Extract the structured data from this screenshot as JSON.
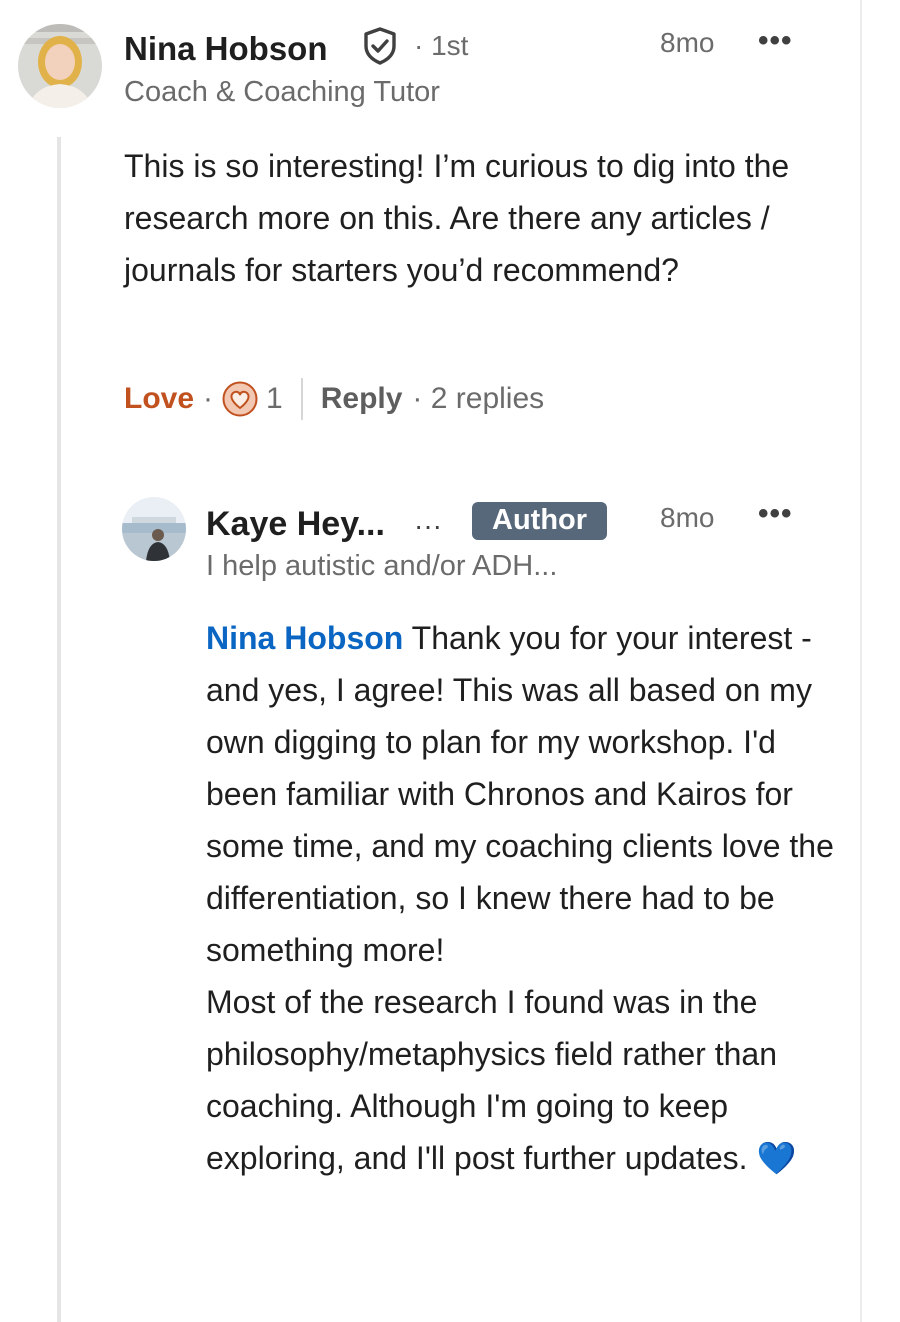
{
  "comment": {
    "author_name": "Nina Hobson",
    "connection": "· 1st",
    "headline": "Coach & Coaching Tutor",
    "time": "8mo",
    "more_label": "•••",
    "text": "This is so interesting! I’m curious to dig into the research more on this. Are there any articles / journals for starters you’d recommend?",
    "reaction_label": "Love",
    "reaction_separator": "·",
    "reaction_count": "1",
    "reply_label": "Reply",
    "replies_text": "· 2 replies"
  },
  "reply": {
    "author_name": "Kaye Hey...",
    "name_more": "···",
    "badge": "Author",
    "headline": "I help autistic and/or ADH...",
    "time": "8mo",
    "more_label": "•••",
    "mention": "Nina Hobson",
    "text": " Thank you for your interest - and yes, I agree! This was all based on my own digging to plan for my workshop. I'd been familiar with Chronos and Kairos for some time, and my coaching clients love the differentiation, so I knew there had to be something more!",
    "text2": "Most of the research I found was in the philosophy/metaphysics field rather than coaching. Although I'm going to keep exploring, and I'll post further updates.",
    "emoji": "💙"
  },
  "colors": {
    "reaction": "#c1511f",
    "mention": "#0a66c2",
    "badge_bg": "#56687a"
  }
}
